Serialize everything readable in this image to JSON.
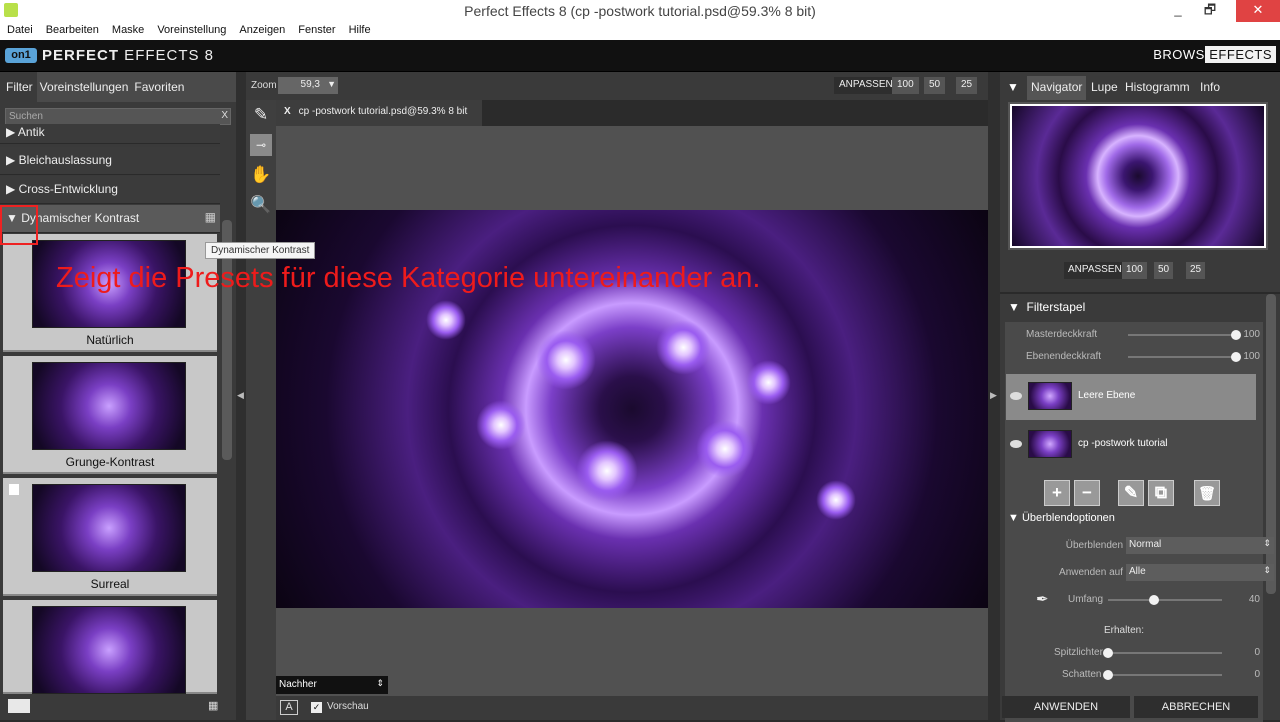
{
  "window": {
    "title": "Perfect Effects 8 (cp -postwork tutorial.psd@59.3% 8 bit)",
    "minimize": "_",
    "restore": "🗗",
    "close": "✕"
  },
  "menu": [
    "Datei",
    "Bearbeiten",
    "Maske",
    "Voreinstellung",
    "Anzeigen",
    "Fenster",
    "Hilfe"
  ],
  "brand": {
    "logo": "on1",
    "name_bold": "PERFECT",
    "name_rest": " EFFECTS 8",
    "browse": "BROWSE",
    "effects": "EFFECTS"
  },
  "left": {
    "tabs": [
      "Filter",
      "Voreinstellungen",
      "Favoriten"
    ],
    "search_placeholder": "Suchen",
    "search_clear": "X",
    "categories": [
      "Antik",
      "Bleichauslassung",
      "Cross-Entwicklung",
      "Dynamischer Kontrast"
    ],
    "presets": [
      "Natürlich",
      "Grunge-Kontrast",
      "Surreal",
      ""
    ],
    "grid_icon": "▦"
  },
  "tooltip": "Dynamischer Kontrast",
  "annotation": "Zeigt die Presets für diese Kategorie untereinander an.",
  "zoom": {
    "label": "Zoom",
    "value": "59,3",
    "fit_label": "ANPASSEN",
    "presets": [
      "100",
      "50",
      "25"
    ]
  },
  "document": {
    "close": "X",
    "tab": "cp -postwork tutorial.psd@59.3% 8 bit"
  },
  "view": {
    "mode": "Nachher",
    "a_label": "A",
    "preview_check": "✓",
    "preview_label": "Vorschau"
  },
  "right": {
    "tabs": [
      "Navigator",
      "Lupe",
      "Histogramm",
      "Info"
    ],
    "nav_fit": {
      "label": "ANPASSEN",
      "presets": [
        "100",
        "50",
        "25"
      ]
    },
    "filterstapel": "Filterstapel",
    "master": {
      "label": "Masterdeckkraft",
      "value": "100",
      "level": 1.0
    },
    "ebene": {
      "label": "Ebenendeckkraft",
      "value": "100",
      "level": 1.0
    },
    "layers": [
      "Leere Ebene",
      "cp -postwork tutorial"
    ],
    "layer_buttons": [
      "+",
      "−",
      "✎",
      "⧉",
      "🗑"
    ],
    "ueberblend": "Überblendoptionen",
    "blend_label": "Überblenden",
    "blend_value": "Normal",
    "apply_label": "Anwenden auf",
    "apply_value": "Alle",
    "umfang_label": "Umfang",
    "umfang_value": "40",
    "umfang_level": 0.4,
    "erhalten": "Erhalten:",
    "spitz_label": "Spitzlichter",
    "spitz_value": "0",
    "schatten_label": "Schatten",
    "schatten_value": "0",
    "apply_btn": "ANWENDEN",
    "cancel_btn": "ABBRECHEN"
  },
  "colors": {
    "accent_red": "#ee1b1b",
    "close_red": "#e04343",
    "logo_blue": "#5aa3d8"
  }
}
